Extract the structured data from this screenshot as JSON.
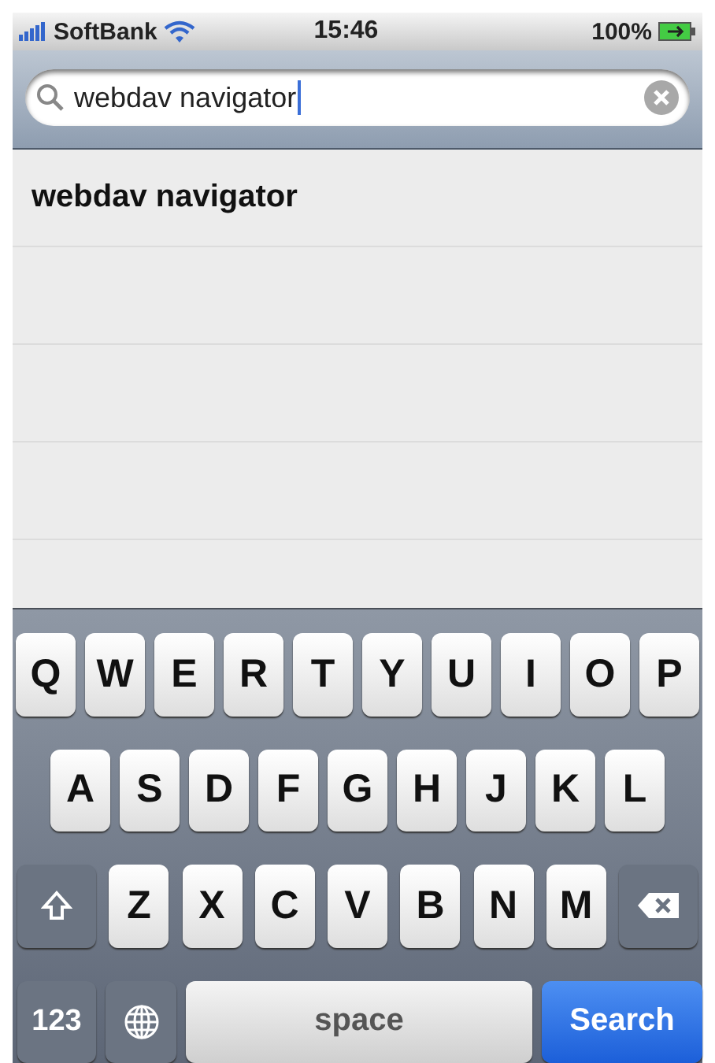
{
  "status_bar": {
    "carrier": "SoftBank",
    "time": "15:46",
    "battery": "100%"
  },
  "search": {
    "value": "webdav navigator"
  },
  "results": [
    {
      "text": "webdav navigator"
    }
  ],
  "keyboard": {
    "rows": [
      {
        "keys": [
          {
            "kind": "letter",
            "label": "Q"
          },
          {
            "kind": "letter",
            "label": "W"
          },
          {
            "kind": "letter",
            "label": "E"
          },
          {
            "kind": "letter",
            "label": "R"
          },
          {
            "kind": "letter",
            "label": "T"
          },
          {
            "kind": "letter",
            "label": "Y"
          },
          {
            "kind": "letter",
            "label": "U"
          },
          {
            "kind": "letter",
            "label": "I"
          },
          {
            "kind": "letter",
            "label": "O"
          },
          {
            "kind": "letter",
            "label": "P"
          }
        ]
      },
      {
        "keys": [
          {
            "kind": "letter",
            "label": "A"
          },
          {
            "kind": "letter",
            "label": "S"
          },
          {
            "kind": "letter",
            "label": "D"
          },
          {
            "kind": "letter",
            "label": "F"
          },
          {
            "kind": "letter",
            "label": "G"
          },
          {
            "kind": "letter",
            "label": "H"
          },
          {
            "kind": "letter",
            "label": "J"
          },
          {
            "kind": "letter",
            "label": "K"
          },
          {
            "kind": "letter",
            "label": "L"
          }
        ]
      },
      {
        "keys": [
          {
            "kind": "shift"
          },
          {
            "kind": "letter",
            "label": "Z"
          },
          {
            "kind": "letter",
            "label": "X"
          },
          {
            "kind": "letter",
            "label": "C"
          },
          {
            "kind": "letter",
            "label": "V"
          },
          {
            "kind": "letter",
            "label": "B"
          },
          {
            "kind": "letter",
            "label": "N"
          },
          {
            "kind": "letter",
            "label": "M"
          },
          {
            "kind": "delete"
          }
        ]
      },
      {
        "keys": [
          {
            "kind": "numbers",
            "label": "123"
          },
          {
            "kind": "globe"
          },
          {
            "kind": "space",
            "label": "space"
          },
          {
            "kind": "search",
            "label": "Search"
          }
        ]
      }
    ]
  }
}
